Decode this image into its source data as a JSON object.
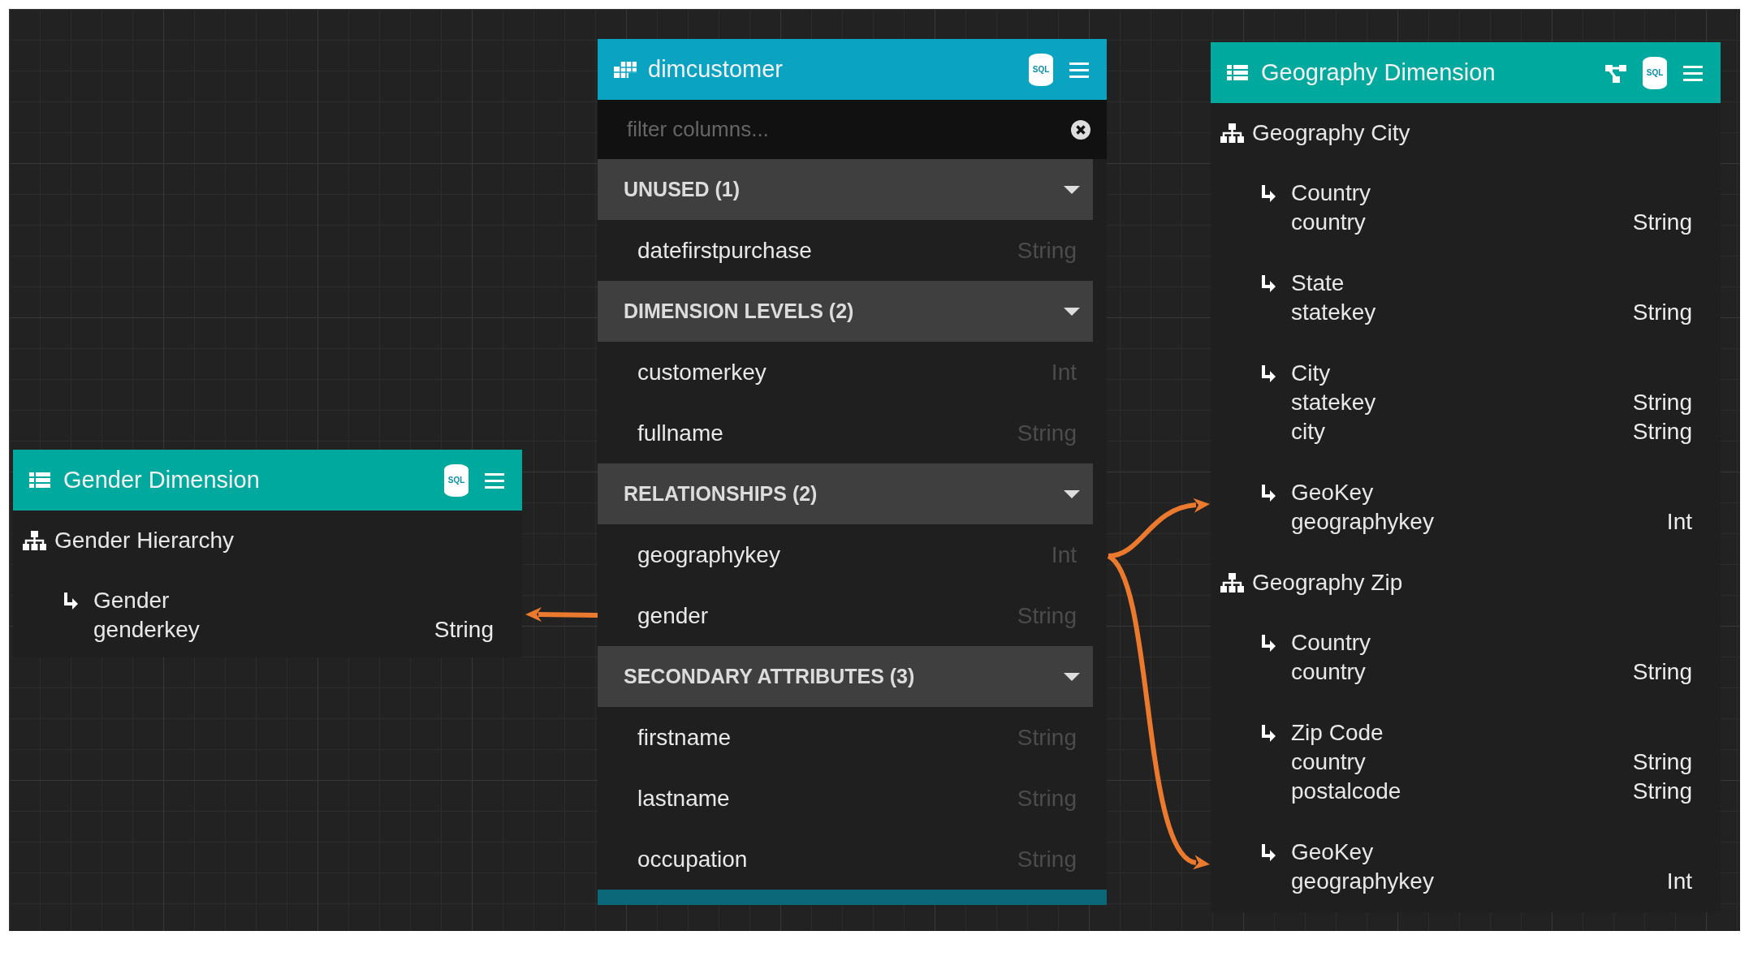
{
  "panels": [
    {
      "kind": "dimension",
      "title": "Gender Dimension",
      "sql_label": "SQL",
      "graph_button": false,
      "hierarchies": [
        {
          "name": "Gender Hierarchy",
          "levels": [
            {
              "name": "Gender",
              "attributes": [
                {
                  "name": "genderkey",
                  "type": "String"
                }
              ]
            }
          ]
        }
      ]
    },
    {
      "kind": "table",
      "title": "dimcustomer",
      "sql_label": "SQL",
      "filter": {
        "placeholder": "filter columns..."
      },
      "sections": [
        {
          "title": "UNUSED (1)",
          "expanded": true,
          "columns": [
            {
              "name": "datefirstpurchase",
              "type": "String"
            }
          ]
        },
        {
          "title": "DIMENSION LEVELS (2)",
          "expanded": true,
          "columns": [
            {
              "name": "customerkey",
              "type": "Int"
            },
            {
              "name": "fullname",
              "type": "String"
            }
          ]
        },
        {
          "title": "RELATIONSHIPS (2)",
          "expanded": true,
          "columns": [
            {
              "name": "geographykey",
              "type": "Int"
            },
            {
              "name": "gender",
              "type": "String"
            }
          ]
        },
        {
          "title": "SECONDARY ATTRIBUTES (3)",
          "expanded": true,
          "columns": [
            {
              "name": "firstname",
              "type": "String"
            },
            {
              "name": "lastname",
              "type": "String"
            },
            {
              "name": "occupation",
              "type": "String"
            }
          ]
        }
      ]
    },
    {
      "kind": "dimension",
      "title": "Geography Dimension",
      "sql_label": "SQL",
      "graph_button": true,
      "hierarchies": [
        {
          "name": "Geography City",
          "levels": [
            {
              "name": "Country",
              "attributes": [
                {
                  "name": "country",
                  "type": "String"
                }
              ]
            },
            {
              "name": "State",
              "attributes": [
                {
                  "name": "statekey",
                  "type": "String"
                }
              ]
            },
            {
              "name": "City",
              "attributes": [
                {
                  "name": "statekey",
                  "type": "String"
                },
                {
                  "name": "city",
                  "type": "String"
                }
              ]
            },
            {
              "name": "GeoKey",
              "attributes": [
                {
                  "name": "geographykey",
                  "type": "Int"
                }
              ]
            }
          ]
        },
        {
          "name": "Geography Zip",
          "levels": [
            {
              "name": "Country",
              "attributes": [
                {
                  "name": "country",
                  "type": "String"
                }
              ]
            },
            {
              "name": "Zip Code",
              "attributes": [
                {
                  "name": "country",
                  "type": "String"
                },
                {
                  "name": "postalcode",
                  "type": "String"
                }
              ]
            },
            {
              "name": "GeoKey",
              "attributes": [
                {
                  "name": "geographykey",
                  "type": "Int"
                }
              ]
            }
          ]
        }
      ]
    }
  ]
}
